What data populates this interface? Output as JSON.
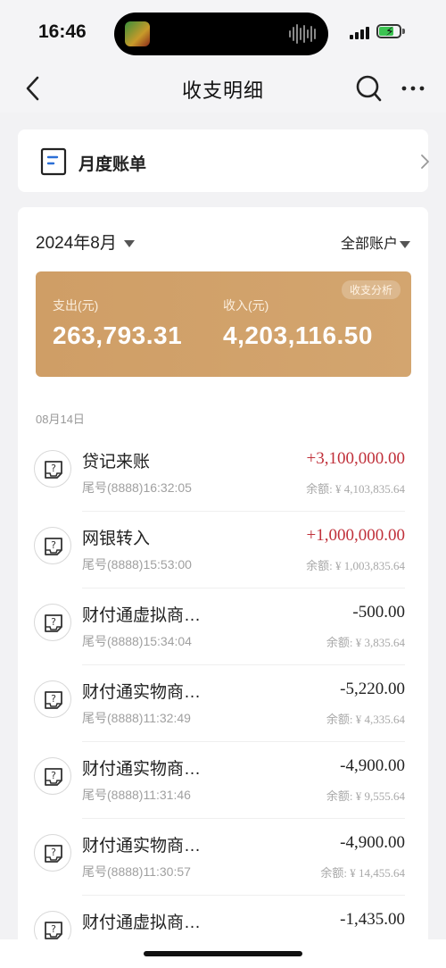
{
  "status_bar": {
    "time": "16:46",
    "icons": [
      "app-thumbnail-icon",
      "audio-wave-icon",
      "signal-icon",
      "battery-charging-icon"
    ]
  },
  "nav": {
    "title": "收支明细",
    "icons": [
      "back-chevron-icon",
      "search-icon",
      "more-icon"
    ]
  },
  "monthly_bill": {
    "label": "月度账单",
    "icons": [
      "document-icon",
      "chevron-right-icon"
    ]
  },
  "filters": {
    "month": "2024年8月",
    "account": "全部账户"
  },
  "summary": {
    "badge": "收支分析",
    "expense_label": "支出(元)",
    "expense_amount": "263,793.31",
    "income_label": "收入(元)",
    "income_amount": "4,203,116.50",
    "colors": {
      "card": "#d1a26b",
      "positive_amount": "#c0303a"
    }
  },
  "date_header": "08月14日",
  "transactions": [
    {
      "name": "贷记来账",
      "meta": "尾号(8888)16:32:05",
      "amount": "+3,100,000.00",
      "balance": "余额: ¥ 4,103,835.64",
      "icon": "unknown-transaction-icon"
    },
    {
      "name": "网银转入",
      "meta": "尾号(8888)15:53:00",
      "amount": "+1,000,000.00",
      "balance": "余额: ¥ 1,003,835.64",
      "icon": "unknown-transaction-icon"
    },
    {
      "name": "财付通虚拟商…",
      "meta": "尾号(8888)15:34:04",
      "amount": "-500.00",
      "balance": "余额: ¥ 3,835.64",
      "icon": "unknown-transaction-icon"
    },
    {
      "name": "财付通实物商…",
      "meta": "尾号(8888)11:32:49",
      "amount": "-5,220.00",
      "balance": "余额: ¥ 4,335.64",
      "icon": "unknown-transaction-icon"
    },
    {
      "name": "财付通实物商…",
      "meta": "尾号(8888)11:31:46",
      "amount": "-4,900.00",
      "balance": "余额: ¥ 9,555.64",
      "icon": "unknown-transaction-icon"
    },
    {
      "name": "财付通实物商…",
      "meta": "尾号(8888)11:30:57",
      "amount": "-4,900.00",
      "balance": "余额: ¥ 14,455.64",
      "icon": "unknown-transaction-icon"
    },
    {
      "name": "财付通虚拟商…",
      "meta": "",
      "amount": "-1,435.00",
      "balance": "",
      "icon": "unknown-transaction-icon"
    }
  ]
}
